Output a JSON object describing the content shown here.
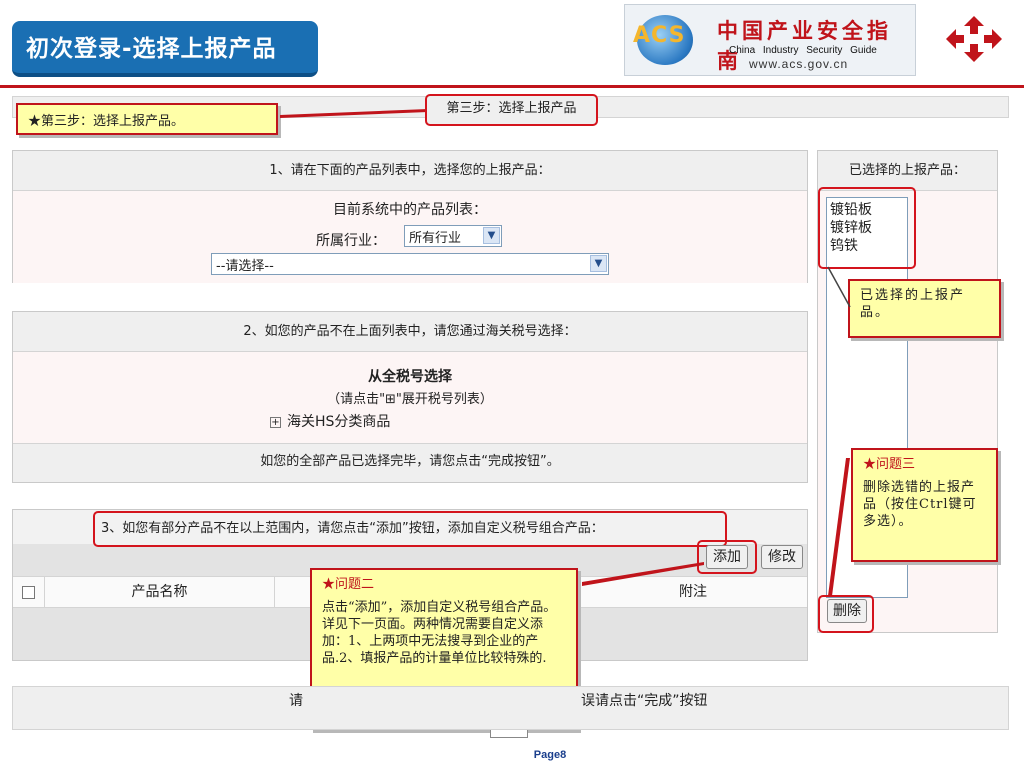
{
  "header": {
    "title": "初次登录-选择上报产品",
    "banner_acs": "ACS",
    "banner_cn": "中国产业安全指南",
    "banner_en": "China  Industry  Security  Guide",
    "banner_url": "www.acs.gov.cn"
  },
  "step": {
    "callout": "★第三步：选择上报产品。",
    "label": "第三步：选择上报产品"
  },
  "section1": {
    "title": "1、请在下面的产品列表中，选择您的上报产品：",
    "list_label": "目前系统中的产品列表：",
    "industry_label": "所属行业：",
    "industry_value": "所有行业",
    "product_select": "--请选择--"
  },
  "selected_panel": {
    "title": "已选择的上报产品：",
    "items": [
      "镀铅板",
      "镀锌板",
      "钨铁"
    ],
    "delete_button": "删除"
  },
  "callout_selected": "已选择的上报产品。",
  "section2": {
    "title": "2、如您的产品不在上面列表中，请您通过海关税号选择：",
    "from_all": "从全税号选择",
    "hint": "（请点击\"⊞\"展开税号列表）",
    "tree_item": "海关HS分类商品",
    "finish_text": "如您的全部产品已选择完毕，请您点击“完成按钮”。"
  },
  "section3": {
    "title": "3、如您有部分产品不在以上范围内，请您点击“添加”按钮，添加自定义税号组合产品：",
    "add_button": "添加",
    "edit_button": "修改",
    "col_name": "产品名称",
    "col_note": "附注"
  },
  "question2": {
    "title": "★问题二",
    "body": "点击“添加”，添加自定义税号组合产品。详见下一页面。两种情况需要自定义添加：1、上两项中无法搜寻到企业的产品.2、填报产品的计量单位比较特殊的."
  },
  "question3": {
    "title": "★问题三",
    "body": "删除选错的上报产品（按住Ctrl键可多选）。"
  },
  "bottom": {
    "left_text": "请",
    "right_text": "误请点击“完成”按钮"
  },
  "footer": {
    "page": "Page8"
  },
  "colors": {
    "accent_blue": "#1a6fb3",
    "callout_yellow": "#ffffa8",
    "highlight_red": "#d4141d"
  }
}
